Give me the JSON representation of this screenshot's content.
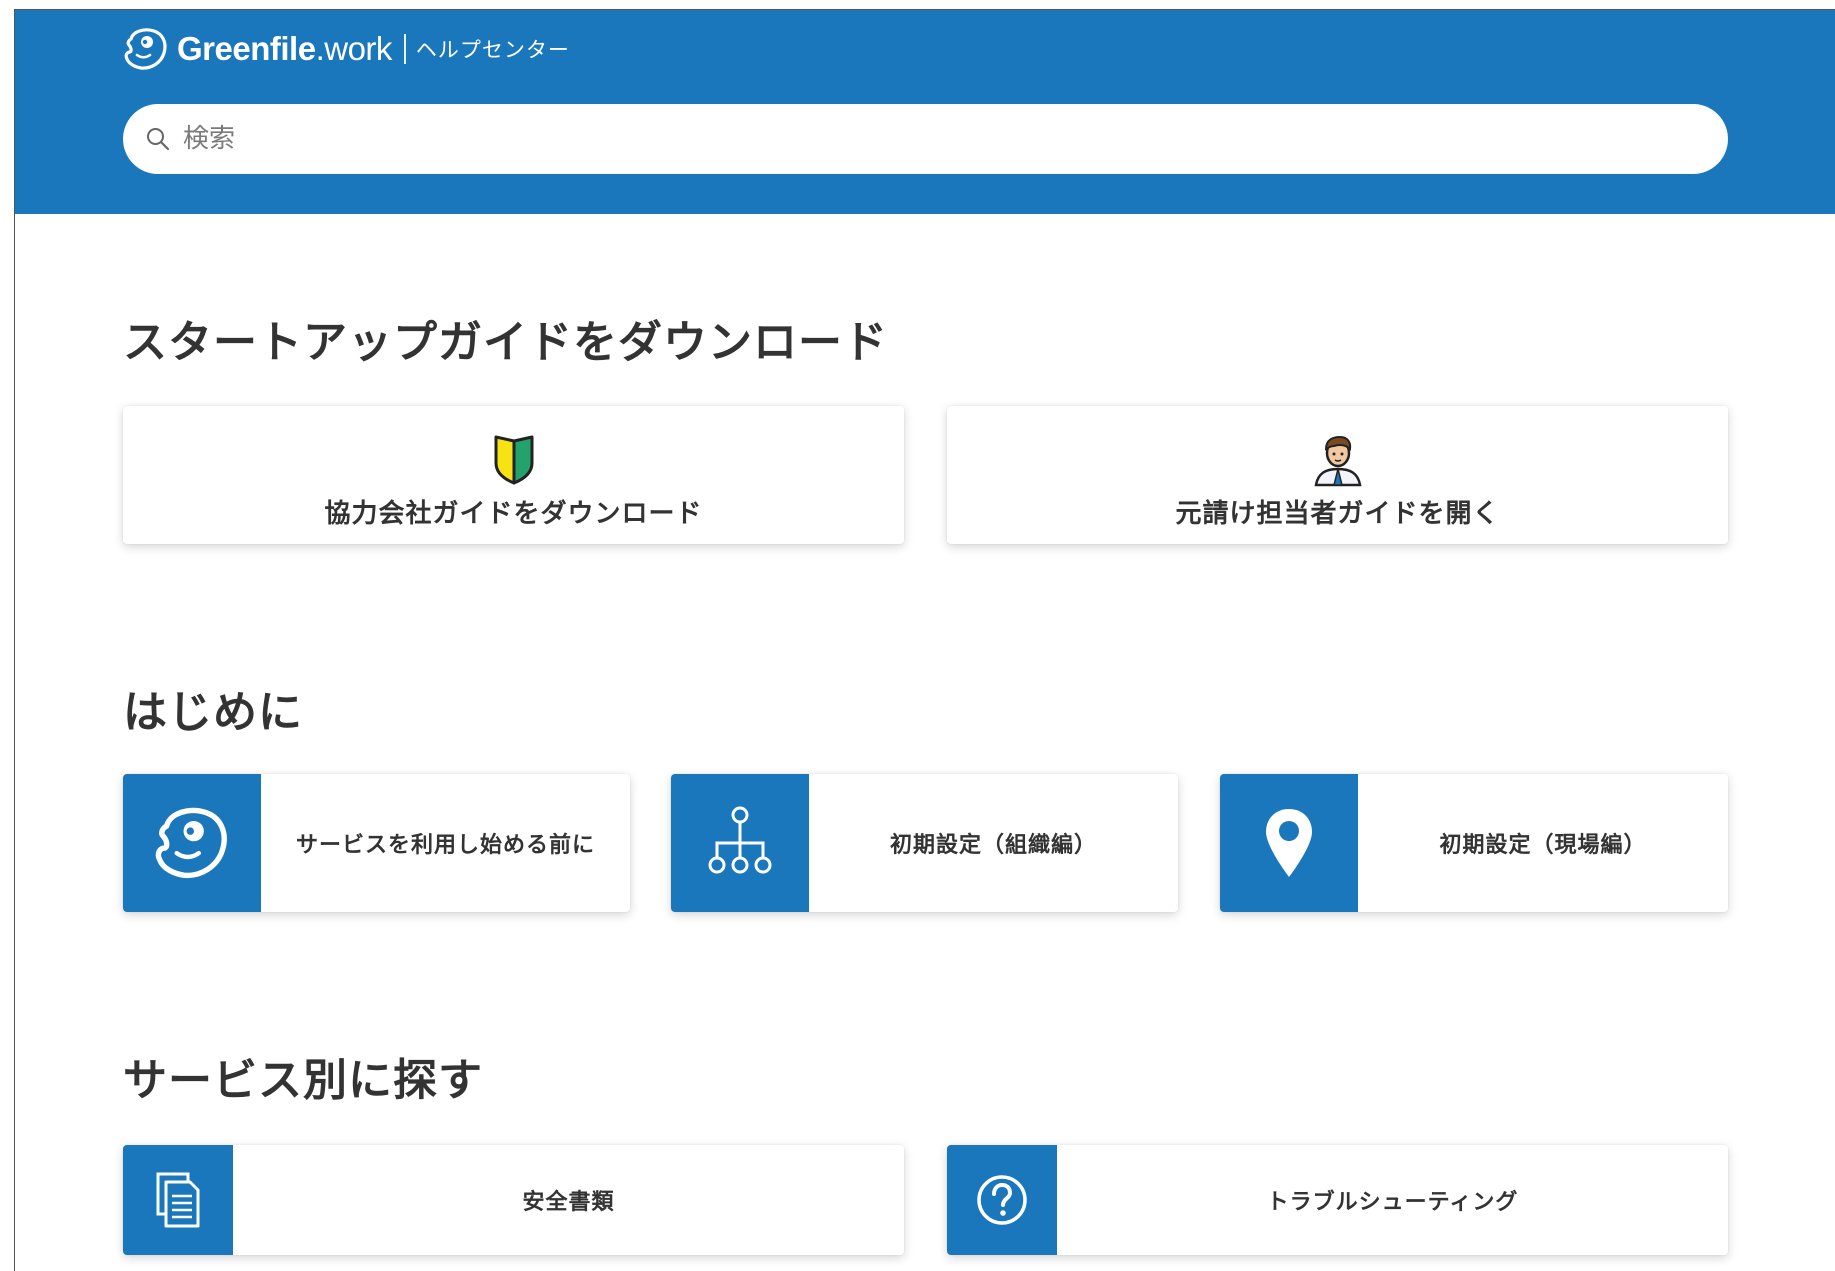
{
  "header": {
    "brand_name_bold": "Greenfile",
    "brand_name_rest": ".work",
    "brand_subtitle": "ヘルプセンター",
    "color": "#1b77bb"
  },
  "search": {
    "placeholder": "検索",
    "value": ""
  },
  "sections": {
    "startup": {
      "title": "スタートアップガイドをダウンロード",
      "cards": [
        {
          "label": "協力会社ガイドをダウンロード",
          "icon": "beginner-mark-icon"
        },
        {
          "label": "元請け担当者ガイドを開く",
          "icon": "businessman-icon"
        }
      ]
    },
    "intro": {
      "title": "はじめに",
      "cards": [
        {
          "label": "サービスを利用し始める前に",
          "icon": "bear-logo-icon"
        },
        {
          "label": "初期設定（組織編）",
          "icon": "org-chart-icon"
        },
        {
          "label": "初期設定（現場編）",
          "icon": "map-pin-icon"
        }
      ]
    },
    "services": {
      "title": "サービス別に探す",
      "cards": [
        {
          "label": "安全書類",
          "icon": "documents-icon"
        },
        {
          "label": "トラブルシューティング",
          "icon": "question-circle-icon"
        }
      ]
    }
  }
}
